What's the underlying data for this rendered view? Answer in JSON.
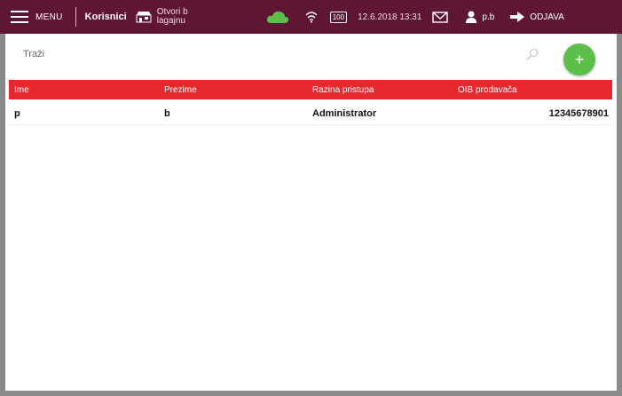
{
  "topbar": {
    "menu_label": "MENU",
    "section_title": "Korisnici",
    "store_label": "Otvori b lagajnu",
    "battery_label": "100",
    "datetime": "12.6.2018 13:31",
    "user_name": "p.b",
    "logout_label": "ODJAVA",
    "cloud_color": "#5bbf4a"
  },
  "search": {
    "placeholder": "Traži"
  },
  "add_button": {
    "label": "+",
    "color": "#5bbf4a"
  },
  "table": {
    "columns": [
      "Ime",
      "Prezime",
      "Razina pristupa",
      "OIB prodavača"
    ],
    "rows": [
      [
        "p",
        "b",
        "Administrator",
        "12345678901"
      ]
    ],
    "header_color": "#e8282f"
  }
}
